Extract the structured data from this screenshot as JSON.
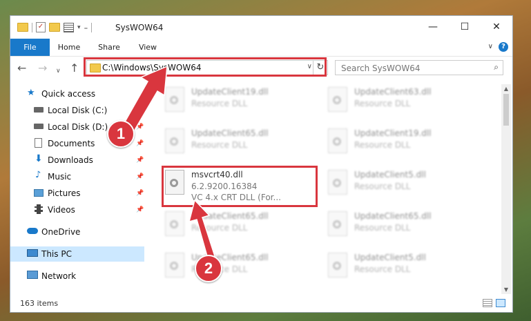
{
  "window": {
    "title": "SysWOW64"
  },
  "window_controls": {
    "minimize": "—",
    "maximize": "☐",
    "close": "✕"
  },
  "ribbon": {
    "tabs": [
      "File",
      "Home",
      "Share",
      "View"
    ],
    "help": "?",
    "collapse": "∨"
  },
  "address": {
    "path": "C:\\Windows\\SysWOW64",
    "dropdown": "∨",
    "refresh": "↻"
  },
  "search": {
    "placeholder": "Search SysWOW64",
    "icon": "search-icon"
  },
  "sidebar": {
    "items": [
      {
        "label": "Quick access",
        "icon": "star-icon"
      },
      {
        "label": "Local Disk (C:)",
        "icon": "drive-icon",
        "pinned": true
      },
      {
        "label": "Local Disk (D:)",
        "icon": "drive-icon",
        "pinned": true
      },
      {
        "label": "Documents",
        "icon": "documents-icon",
        "pinned": true
      },
      {
        "label": "Downloads",
        "icon": "downloads-icon",
        "pinned": true
      },
      {
        "label": "Music",
        "icon": "music-icon",
        "pinned": true
      },
      {
        "label": "Pictures",
        "icon": "pictures-icon",
        "pinned": true
      },
      {
        "label": "Videos",
        "icon": "videos-icon",
        "pinned": true
      },
      {
        "label": "OneDrive",
        "icon": "cloud-icon"
      },
      {
        "label": "This PC",
        "icon": "computer-icon",
        "selected": true
      },
      {
        "label": "Network",
        "icon": "network-icon"
      }
    ]
  },
  "files": {
    "left": [
      {
        "name": "UpdateClient19.dll",
        "desc": "Resource DLL"
      },
      {
        "name": "UpdateClient65.dll",
        "desc": "Resource DLL"
      },
      {
        "name": "msvcrt40.dll",
        "desc": "6.2.9200.16384",
        "extra": "VC 4.x CRT DLL (For..."
      },
      {
        "name": "UpdateClient65.dll",
        "desc": "Resource DLL"
      },
      {
        "name": "UpdateClient65.dll",
        "desc": "Resource DLL"
      }
    ],
    "right": [
      {
        "name": "UpdateClient63.dll",
        "desc": "Resource DLL"
      },
      {
        "name": "UpdateClient19.dll",
        "desc": "Resource DLL"
      },
      {
        "name": "UpdateClient5.dll",
        "desc": "Resource DLL"
      },
      {
        "name": "UpdateClient65.dll",
        "desc": "Resource DLL"
      },
      {
        "name": "UpdateClient5.dll",
        "desc": "Resource DLL"
      }
    ]
  },
  "status": {
    "count": "163 items"
  },
  "callouts": [
    "1",
    "2"
  ],
  "colors": {
    "accent": "#1979ca",
    "highlight": "#d9363e",
    "selected": "#cce8ff"
  }
}
